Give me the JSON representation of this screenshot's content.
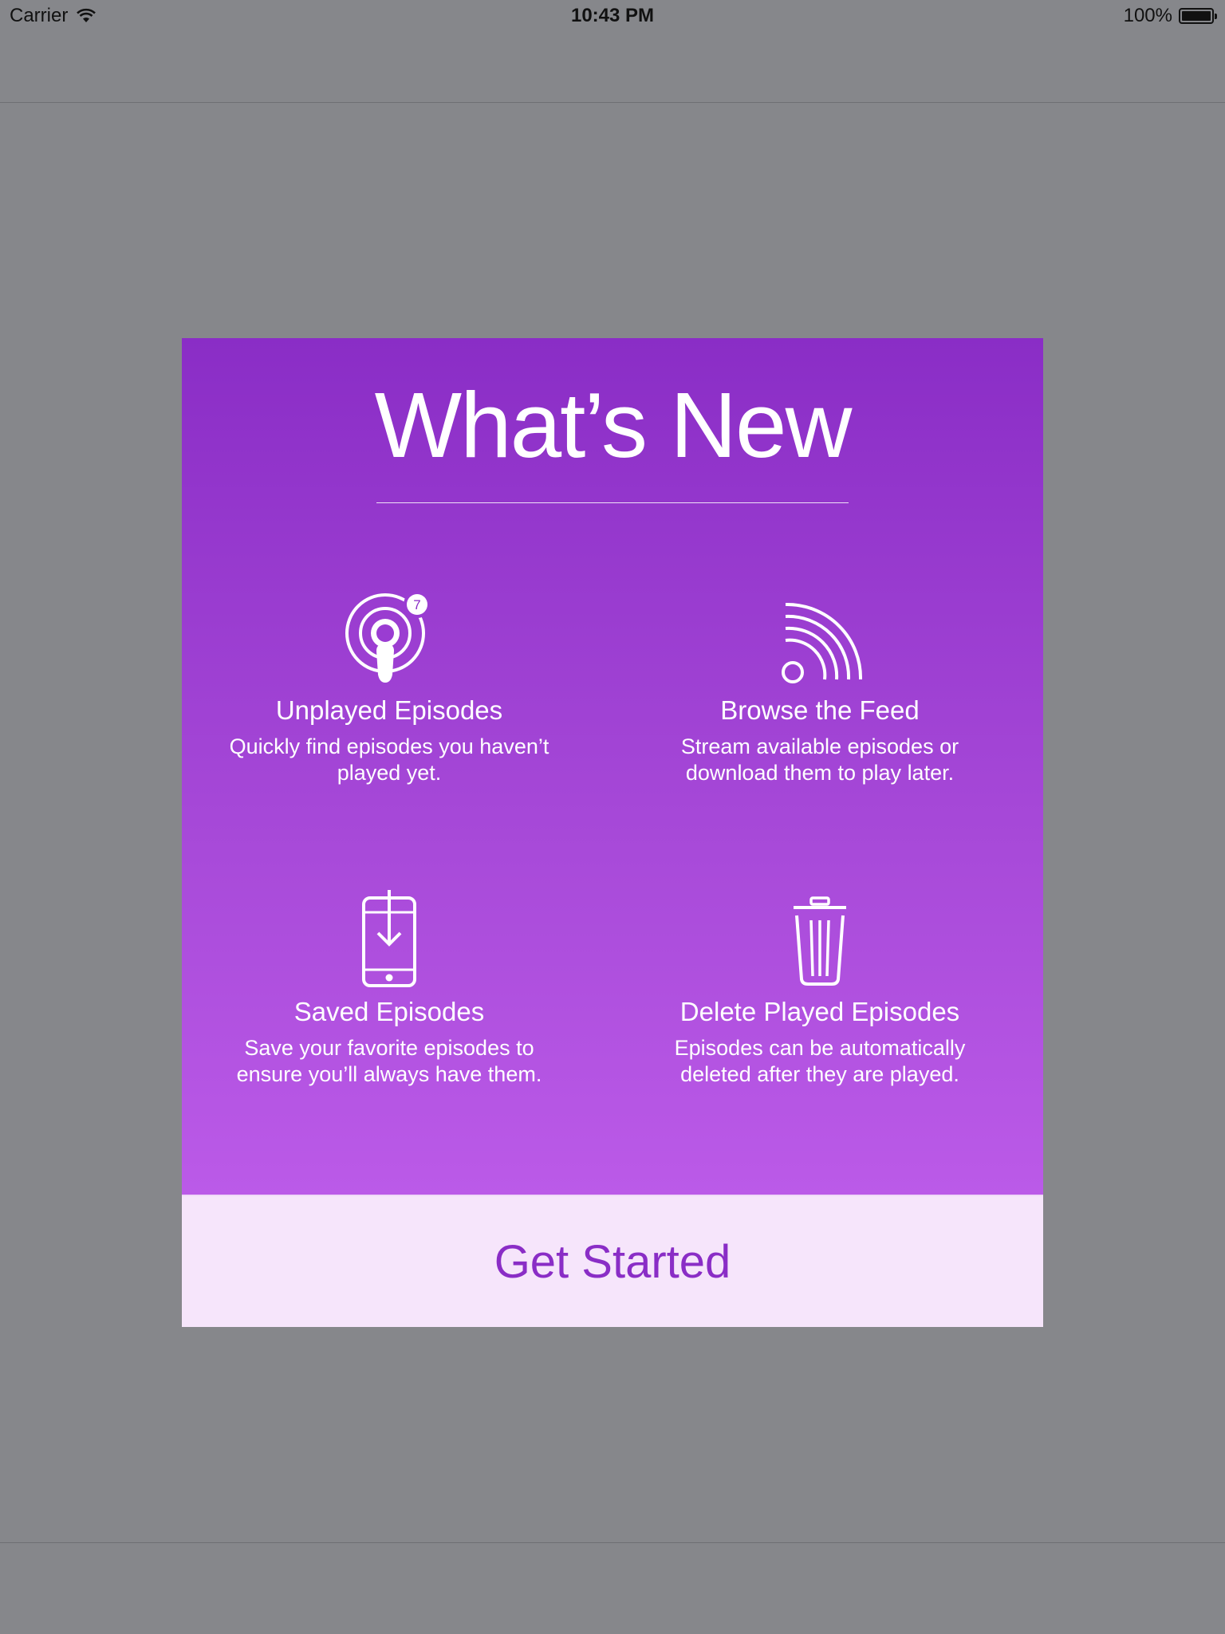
{
  "status_bar": {
    "carrier": "Carrier",
    "time": "10:43 PM",
    "battery": "100%"
  },
  "modal": {
    "title": "What’s New",
    "features": [
      {
        "icon": "podcast-badge-icon",
        "badge": "7",
        "title": "Unplayed Episodes",
        "description": "Quickly find episodes you haven’t played yet."
      },
      {
        "icon": "rss-feed-icon",
        "title": "Browse the Feed",
        "description": "Stream available episodes or download them to play later."
      },
      {
        "icon": "phone-download-icon",
        "title": "Saved Episodes",
        "description": "Save your favorite episodes to ensure you’ll always have them."
      },
      {
        "icon": "trash-icon",
        "title": "Delete Played Episodes",
        "description": "Episodes can be automatically deleted after they are played."
      }
    ],
    "button_label": "Get Started"
  },
  "colors": {
    "gradient_top": "#8a2dc6",
    "gradient_bottom": "#bb5ae8",
    "button_bg": "#f6e5fb",
    "button_text": "#8a2dc6",
    "backdrop": "#86878b"
  }
}
